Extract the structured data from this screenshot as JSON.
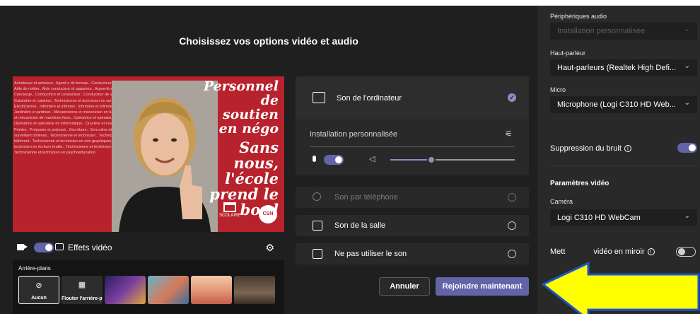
{
  "main": {
    "title": "Choisissez vos options vidéo et audio",
    "preview": {
      "background_text": "Acheteuse et acheteur.. Agent-e de bureau.. Conducteur de véhicules lourds.. Aide de métier.. Aide conducteur et apparieur.. Apprenti-e de métiers.. Auxiliaire.. Concierge.. Conductrice et conducteur.. Conducteur de véhicules lourds.. Cuisinière et cuisinier.. Technicienne et technicien en service de garde.. Électricienne.. Infirmière et infirmier.. Infirmière et infirmier en transport scolaire.. Jardinière et jardinier.. Mécanicienne et mécanicien en tuyauterie.. Mécanicienne et mécanicien de machines fixes.. Opératrice et opérateur en imprimerie.. Opératrice et opérateur en informatique.. Ouvrière et ouvrier certifié d'entretien.. Peintre.. Préposée et préposé.. Secrétaire.. Serrurière et serrurier.. Surveillante et surveillant d'élèves.. Technicienne et technicien.. Technicienne et technicien en bâtiment.. Technicienne et technicien en arts graphiques.. Technicienne et technicien en écriture braille.. Technicienne et technicien en informatique.. Technicienne et technicien en psychoéducation",
      "slogan_line1": "Personnel de soutien en négo",
      "slogan_line2": "Sans nous, l'école prend le bord",
      "logo_left_text": "SCOLAIRE",
      "logo_csn": "CSN"
    },
    "video_controls": {
      "camera_icon": "video-camera-icon",
      "camera_on": true,
      "effects_label": "Effets vidéo",
      "settings_icon": "gear-icon"
    },
    "backgrounds": {
      "label": "Arrière-plans",
      "none_label": "Aucun",
      "blur_label": "Flouter l'arrière-plan",
      "thumb_colors": [
        "#3b2a6e",
        "#c46a52",
        "#d9825f",
        "#5a4a3a"
      ]
    },
    "audio": {
      "computer_sound_label": "Son de l'ordinateur",
      "device_label": "Installation personnalisée",
      "mic_on": true,
      "volume_fraction": 0.33,
      "phone_label": "Son par téléphone",
      "room_label": "Son de la salle",
      "no_audio_label": "Ne pas utiliser le son"
    },
    "buttons": {
      "cancel": "Annuler",
      "join": "Rejoindre maintenant"
    }
  },
  "side": {
    "audio_devices_label": "Périphériques audio",
    "audio_devices_value": "Installation personnalisée",
    "speaker_label": "Haut-parleur",
    "speaker_value": "Haut-parleurs (Realtek High Defi...",
    "mic_label": "Micro",
    "mic_value": "Microphone (Logi C310 HD Web...",
    "noise_label": "Suppression du bruit",
    "noise_on": true,
    "video_header": "Paramètres vidéo",
    "camera_label": "Caméra",
    "camera_value": "Logi C310 HD WebCam",
    "mirror_label_start": "Mett",
    "mirror_label_end": "vidéo en miroir",
    "mirror_on": false
  },
  "colors": {
    "accent": "#6264a7",
    "preview_red": "#b8222c",
    "arrow_fill": "#ffff00",
    "arrow_stroke": "#1a56c9"
  }
}
